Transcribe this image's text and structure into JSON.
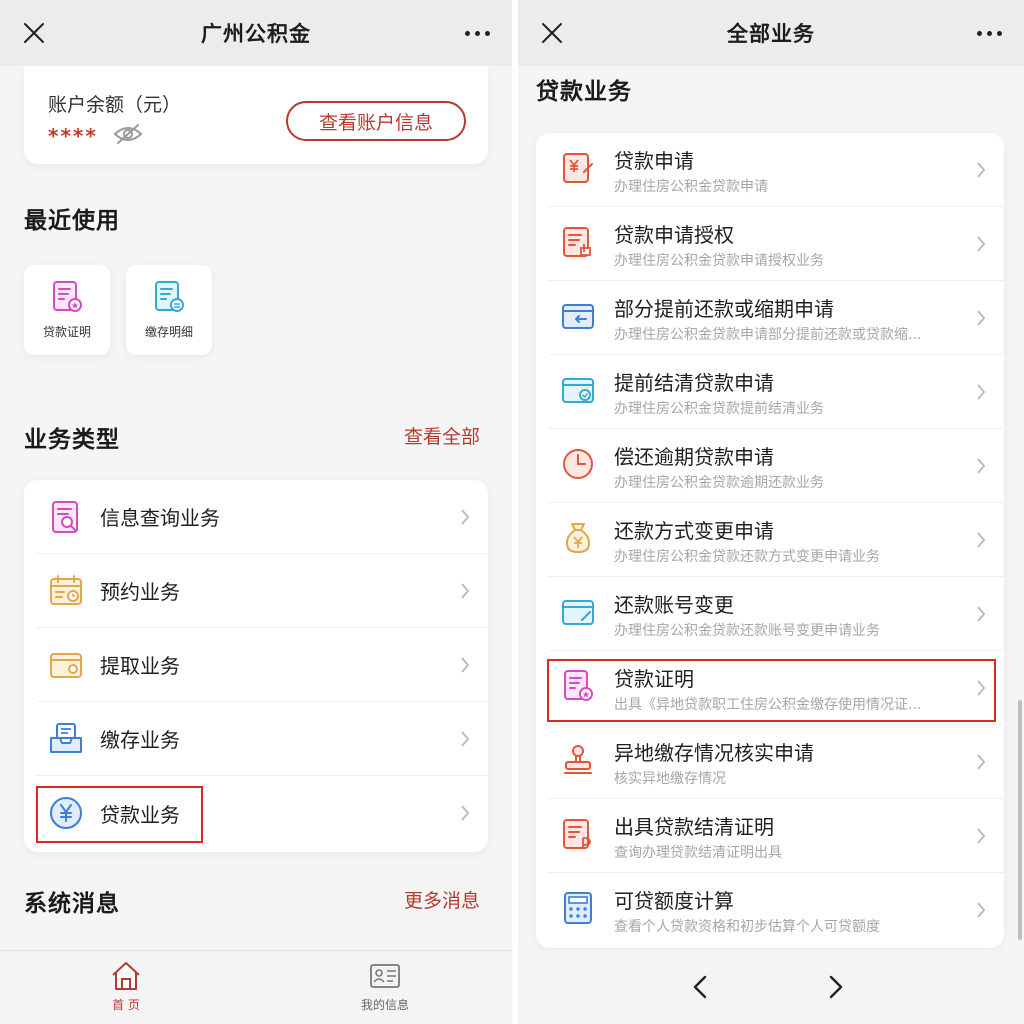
{
  "left": {
    "header": {
      "title": "广州公积金",
      "close_icon": "close-icon",
      "more_icon": "more-icon"
    },
    "balance": {
      "label": "账户余额（元）",
      "masked_value": "****",
      "toggle_icon": "eye-off-icon",
      "button": "查看账户信息"
    },
    "recent": {
      "title": "最近使用",
      "items": [
        {
          "label": "贷款证明",
          "icon": "loan-certificate-icon",
          "color": "#d34cc0"
        },
        {
          "label": "缴存明细",
          "icon": "deposit-detail-icon",
          "color": "#34a9d6"
        }
      ]
    },
    "types": {
      "title": "业务类型",
      "link": "查看全部",
      "items": [
        {
          "label": "信息查询业务",
          "icon": "info-query-icon",
          "color": "#d34cc0"
        },
        {
          "label": "预约业务",
          "icon": "calendar-icon",
          "color": "#e3a74a"
        },
        {
          "label": "提取业务",
          "icon": "wallet-icon",
          "color": "#e3a74a"
        },
        {
          "label": "缴存业务",
          "icon": "inbox-icon",
          "color": "#3d7fd4"
        },
        {
          "label": "贷款业务",
          "icon": "yuan-icon",
          "color": "#3d7fd4"
        }
      ]
    },
    "messages": {
      "title": "系统消息",
      "link": "更多消息"
    },
    "bottom_nav": {
      "home": {
        "label": "首 页",
        "icon": "home-icon"
      },
      "info": {
        "label": "我的信息",
        "icon": "id-card-icon"
      }
    }
  },
  "right": {
    "header": {
      "title": "全部业务",
      "close_icon": "close-icon",
      "more_icon": "more-icon"
    },
    "section_title": "贷款业务",
    "items": [
      {
        "name": "贷款申请",
        "desc": "办理住房公积金贷款申请",
        "icon": "loan-apply-icon",
        "color": "#e0563c"
      },
      {
        "name": "贷款申请授权",
        "desc": "办理住房公积金贷款申请授权业务",
        "icon": "loan-auth-icon",
        "color": "#e0563c"
      },
      {
        "name": "部分提前还款或缩期申请",
        "desc": "办理住房公积金贷款申请部分提前还款或贷款缩...",
        "icon": "partial-repay-icon",
        "color": "#3d7fd4"
      },
      {
        "name": "提前结清贷款申请",
        "desc": "办理住房公积金贷款提前结清业务",
        "icon": "card-check-icon",
        "color": "#34a9d6"
      },
      {
        "name": "偿还逾期贷款申请",
        "desc": "办理住房公积金贷款逾期还款业务",
        "icon": "clock-icon",
        "color": "#e0563c"
      },
      {
        "name": "还款方式变更申请",
        "desc": "办理住房公积金贷款还款方式变更申请业务",
        "icon": "money-bag-icon",
        "color": "#e3a74a"
      },
      {
        "name": "还款账号变更",
        "desc": "办理住房公积金贷款还款账号变更申请业务",
        "icon": "card-edit-icon",
        "color": "#34a9d6"
      },
      {
        "name": "贷款证明",
        "desc": "出具《异地贷款职工住房公积金缴存使用情况证...",
        "icon": "loan-certificate-icon",
        "color": "#d34cc0"
      },
      {
        "name": "异地缴存情况核实申请",
        "desc": "核实异地缴存情况",
        "icon": "stamp-icon",
        "color": "#e0563c"
      },
      {
        "name": "出具贷款结清证明",
        "desc": "查询办理贷款结清证明出具",
        "icon": "settle-certificate-icon",
        "color": "#e0563c"
      },
      {
        "name": "可贷额度计算",
        "desc": "查看个人贷款资格和初步估算个人可贷额度",
        "icon": "calculator-icon",
        "color": "#3d7fd4"
      }
    ],
    "bottom_nav": {
      "back_icon": "chevron-left-icon",
      "forward_icon": "chevron-right-icon"
    }
  },
  "colors": {
    "accent": "#b53a32",
    "highlight_box": "#d92b25",
    "background": "#f5f5f5"
  }
}
